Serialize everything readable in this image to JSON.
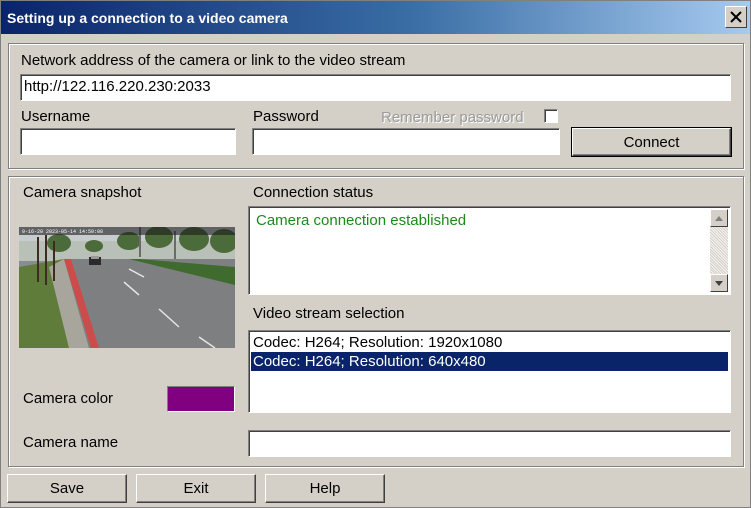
{
  "window": {
    "title": "Setting up a connection to a video camera",
    "close_symbol": "×"
  },
  "connection": {
    "address_label": "Network address of the camera or link to the video stream",
    "address_value": "http://122.116.220.230:2033",
    "username_label": "Username",
    "username_value": "",
    "password_label": "Password",
    "password_value": "",
    "remember_label": "Remember password",
    "remember_checked": false,
    "connect_label": "Connect"
  },
  "camera": {
    "snapshot_label": "Camera snapshot",
    "snapshot_overlay_text": "9-16-20 2023-05-14 14:50:08",
    "color_label": "Camera color",
    "color_value": "#800080",
    "name_label": "Camera name",
    "name_value": ""
  },
  "status": {
    "label": "Connection status",
    "message": "Camera connection established",
    "message_color": "#1a8a1a"
  },
  "streams": {
    "label": "Video stream selection",
    "items": [
      "Codec: H264; Resolution: 1920x1080",
      "Codec: H264; Resolution: 640x480"
    ],
    "selected": 1
  },
  "footer": {
    "save_label": "Save",
    "exit_label": "Exit",
    "help_label": "Help"
  }
}
